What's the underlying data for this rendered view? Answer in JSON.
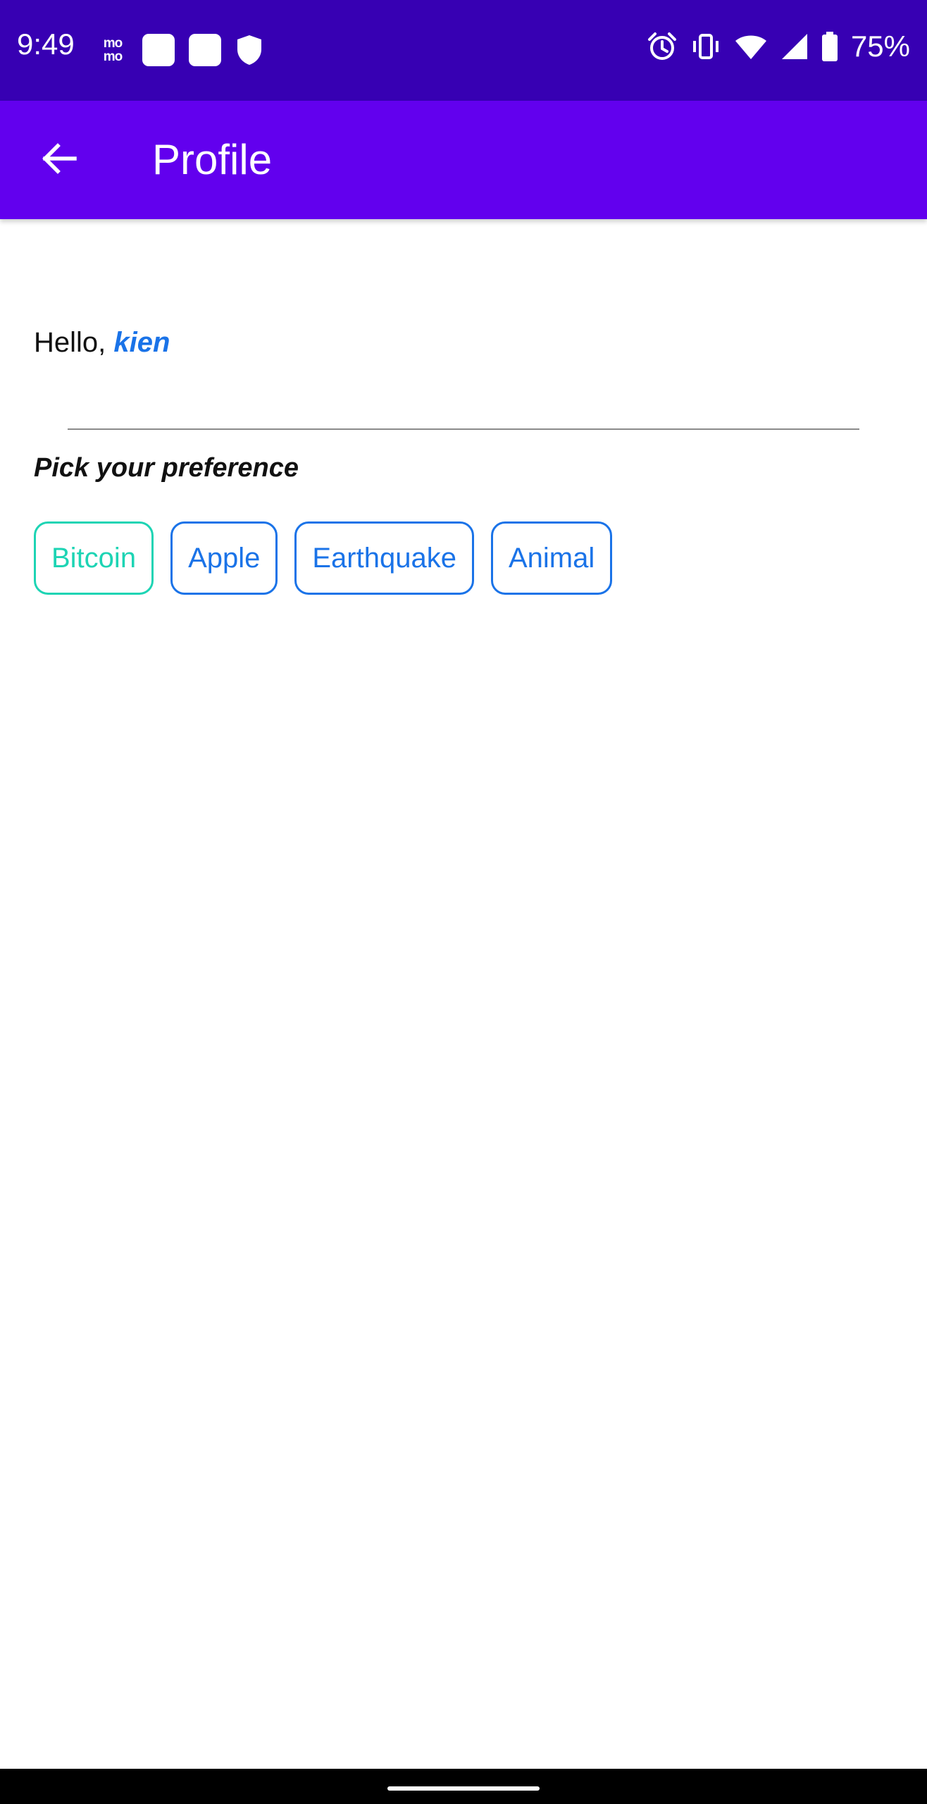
{
  "status_bar": {
    "time": "9:49",
    "battery": "75%",
    "left_icons": [
      "momo-icon",
      "notification-square-icon",
      "notification-square-icon",
      "shield-icon"
    ],
    "right_icons": [
      "alarm-icon",
      "vibrate-icon",
      "wifi-icon",
      "cell-signal-icon",
      "battery-icon"
    ],
    "background": "#3700b3",
    "momo_top": "mo",
    "momo_bottom": "mo"
  },
  "app_bar": {
    "title": "Profile",
    "back_icon": "arrow-back-icon",
    "background": "#6200ee"
  },
  "profile": {
    "greeting_prefix": "Hello, ",
    "user_name": "kien",
    "section_title": "Pick your preference",
    "preferences": [
      {
        "label": "Bitcoin",
        "selected": true
      },
      {
        "label": "Apple",
        "selected": false
      },
      {
        "label": "Earthquake",
        "selected": false
      },
      {
        "label": "Animal",
        "selected": false
      }
    ]
  },
  "colors": {
    "accent": "#1a73e8",
    "selected_chip": "#1dd4b4"
  }
}
